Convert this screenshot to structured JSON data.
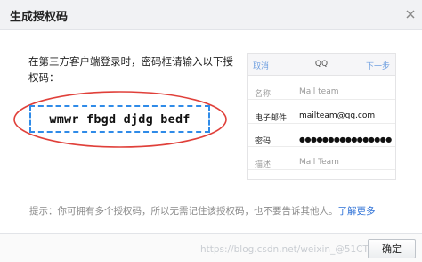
{
  "dialog": {
    "title": "生成授权码",
    "instruction": "在第三方客户端登录时，密码框请输入以下授权码：",
    "auth_code": "wmwr fbgd djdg bedf",
    "phone_preview": {
      "cancel": "取消",
      "title": "QQ",
      "next": "下一步",
      "rows": [
        {
          "label": "名称",
          "value": "Mail team",
          "style": "dim"
        },
        {
          "label": "电子邮件",
          "value": "mailteam@qq.com",
          "style": "dark"
        },
        {
          "label": "密码",
          "value": "●●●●●●●●●●●●●●●●",
          "style": "pwd"
        },
        {
          "label": "描述",
          "value": "Mail Team",
          "style": "dim"
        }
      ]
    },
    "tip": "提示：你可拥有多个授权码，所以无需记住该授权码，也不要告诉其他人。",
    "learn_more": "了解更多",
    "ok_label": "确定",
    "watermark": "https://blog.csdn.net/weixin_@51CTO博客"
  },
  "colors": {
    "accent": "#2f8be8",
    "link": "#2b6fd6",
    "highlight": "#e0403a"
  }
}
